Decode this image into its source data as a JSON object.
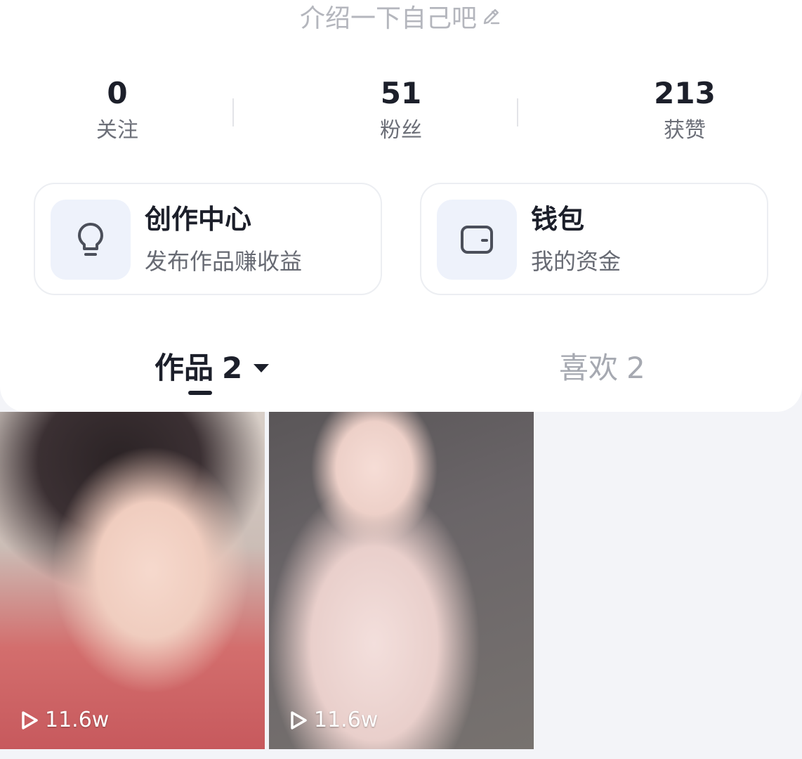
{
  "profile": {
    "bio_placeholder": "介绍一下自己吧"
  },
  "stats": [
    {
      "value": "0",
      "label": "关注"
    },
    {
      "value": "51",
      "label": "粉丝"
    },
    {
      "value": "213",
      "label": "获赞"
    }
  ],
  "entries": {
    "creator": {
      "title": "创作中心",
      "subtitle": "发布作品赚收益",
      "icon": "lightbulb-icon"
    },
    "wallet": {
      "title": "钱包",
      "subtitle": "我的资金",
      "icon": "wallet-icon"
    }
  },
  "tabs": {
    "works": {
      "label": "作品",
      "count": "2"
    },
    "likes": {
      "label": "喜欢",
      "count": "2"
    }
  },
  "videos": [
    {
      "play_count": "11.6w"
    },
    {
      "play_count": "11.6w"
    }
  ],
  "colors": {
    "primary_text": "#1c1f2a",
    "secondary_text": "#6c6f78",
    "muted_text": "#b4b6bd",
    "icon_bg": "#eef2fb",
    "page_bg": "#f3f4f8"
  }
}
